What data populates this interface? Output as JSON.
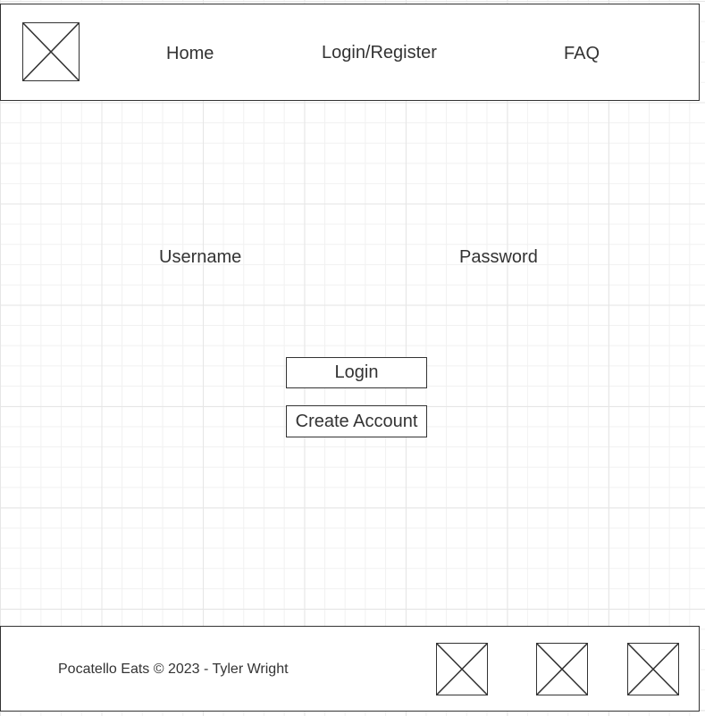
{
  "header": {
    "logo_icon": "image-placeholder-icon",
    "nav": {
      "home": "Home",
      "login_register": "Login/Register",
      "faq": "FAQ"
    }
  },
  "login_form": {
    "username_label": "Username",
    "password_label": "Password",
    "login_button": "Login",
    "create_account_button": "Create Account"
  },
  "footer": {
    "copyright": "Pocatello Eats © 2023 - Tyler Wright",
    "social_icons": [
      "image-placeholder-icon",
      "image-placeholder-icon",
      "image-placeholder-icon"
    ]
  },
  "colors": {
    "border": "#333333",
    "text": "#333333",
    "grid": "#e6e6e6",
    "background": "#ffffff"
  }
}
